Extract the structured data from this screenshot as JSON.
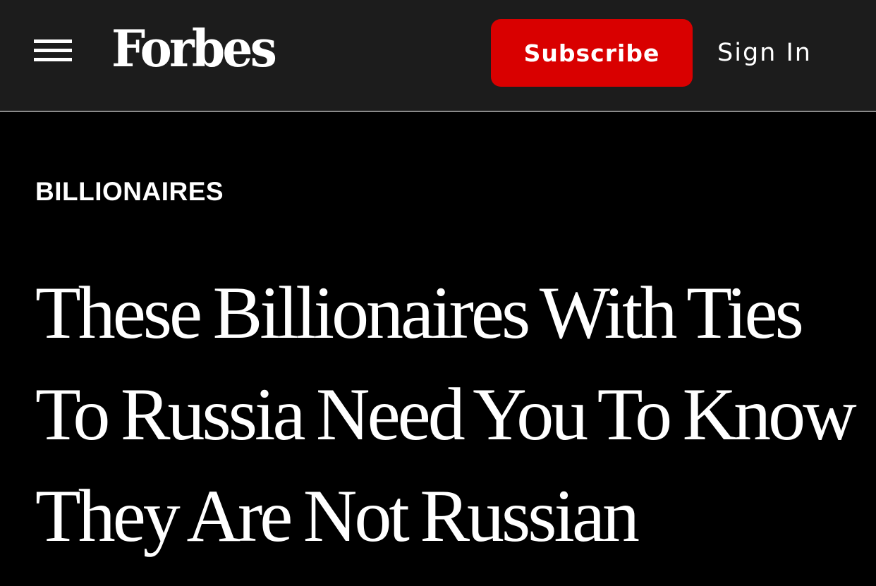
{
  "header": {
    "logo_text": "Forbes",
    "subscribe_label": "Subscribe",
    "signin_label": "Sign In",
    "menu_icon": "hamburger-menu-icon",
    "background_color": "#1c1c1c",
    "subscribe_color": "#d90000"
  },
  "article": {
    "section": "BILLIONAIRES",
    "headline_lines": [
      "These Billionaires With Ties",
      "To Russia Need You To Know",
      "They Are Not Russian"
    ]
  }
}
